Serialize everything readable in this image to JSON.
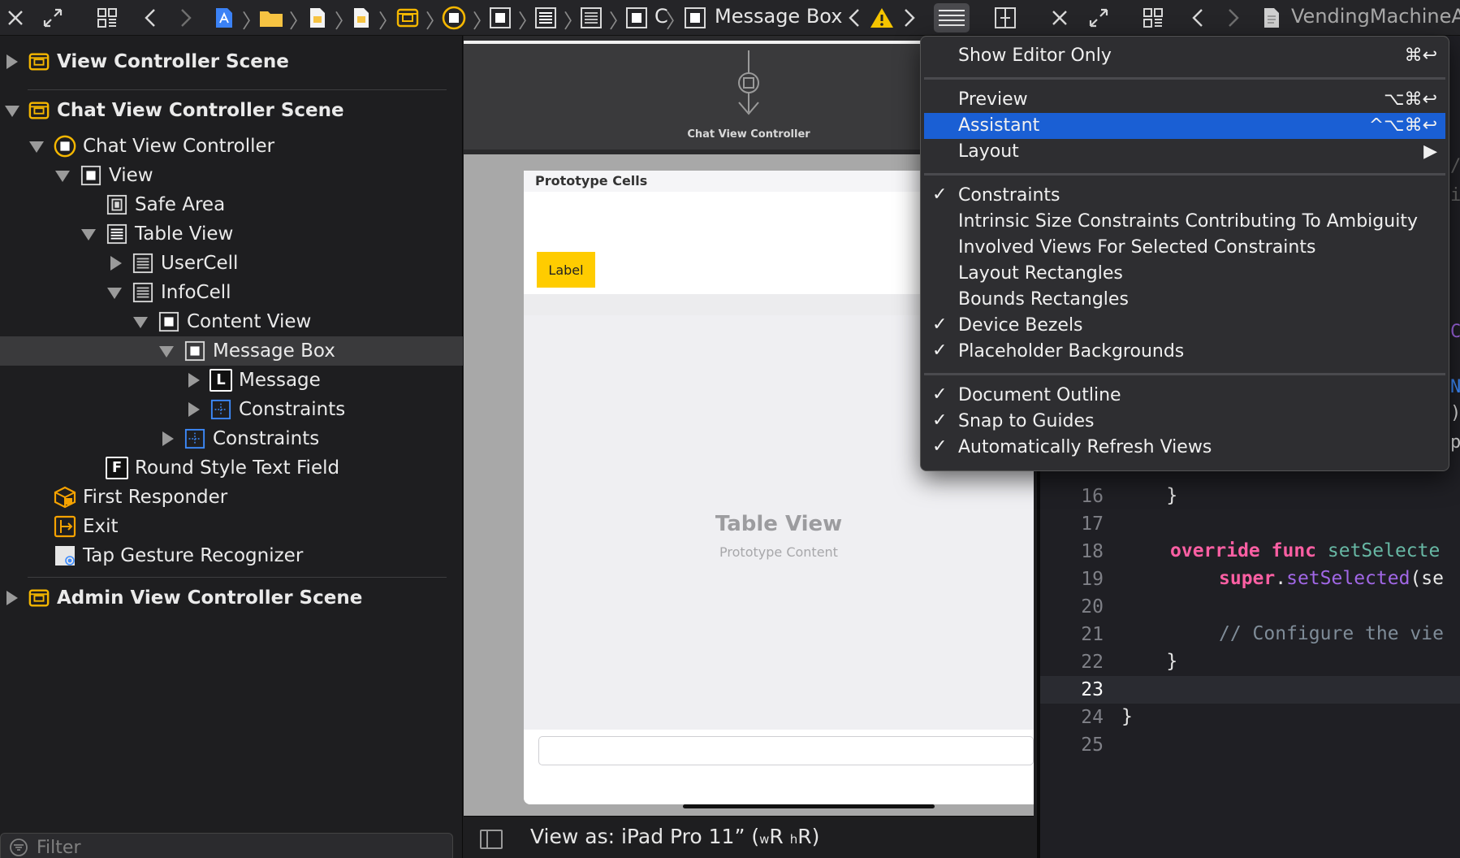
{
  "toolbar": {
    "breadcrumb_current": "Message Box",
    "breadcrumb_c": "C",
    "right_file": "VendingMachineApp"
  },
  "outline": {
    "rows": [
      {
        "label": "View Controller Scene"
      },
      {
        "label": "Chat View Controller Scene"
      },
      {
        "label": "Chat View Controller"
      },
      {
        "label": "View"
      },
      {
        "label": "Safe Area"
      },
      {
        "label": "Table View"
      },
      {
        "label": "UserCell"
      },
      {
        "label": "InfoCell"
      },
      {
        "label": "Content View"
      },
      {
        "label": "Message Box"
      },
      {
        "label": "Message"
      },
      {
        "label": "Constraints"
      },
      {
        "label": "Constraints"
      },
      {
        "label": "Round Style Text Field"
      },
      {
        "label": "First Responder"
      },
      {
        "label": "Exit"
      },
      {
        "label": "Tap Gesture Recognizer"
      },
      {
        "label": "Admin View Controller Scene"
      }
    ],
    "icon_letters": {
      "label": "L",
      "field": "F"
    },
    "filter_placeholder": "Filter"
  },
  "canvas": {
    "scene_label": "Chat View Controller",
    "prototype_cells": "Prototype Cells",
    "label_text": "Label",
    "table_view_title": "Table View",
    "table_view_sub": "Prototype Content",
    "view_as": "View as: iPad Pro 11” (",
    "view_as_w": "w",
    "view_as_r1": "R ",
    "view_as_h": "h",
    "view_as_r2": "R)"
  },
  "editor": {
    "lines": [
      {
        "num": "16",
        "code": "    }"
      },
      {
        "num": "17",
        "code": ""
      },
      {
        "num": "18",
        "kw": "override func ",
        "fn": "setSelecte"
      },
      {
        "num": "19",
        "kw": "super",
        "plain": ".",
        "mt": "setSelected",
        "rest": "(se"
      },
      {
        "num": "20",
        "code": ""
      },
      {
        "num": "21",
        "cm": "// Configure the vie"
      },
      {
        "num": "22",
        "code": "    }"
      },
      {
        "num": "23",
        "code": ""
      },
      {
        "num": "24",
        "code": "}"
      },
      {
        "num": "25",
        "code": ""
      }
    ],
    "edge_glyphs": [
      "/",
      "i",
      "C",
      "N",
      ")",
      "p"
    ]
  },
  "menu": {
    "items": [
      {
        "label": "Show Editor Only",
        "shortcut": "⌘↩",
        "checked": false
      },
      {
        "label": "Preview",
        "shortcut": "⌥⌘↩",
        "checked": false
      },
      {
        "label": "Assistant",
        "shortcut": "^⌥⌘↩",
        "checked": false
      },
      {
        "label": "Layout",
        "shortcut": "▶",
        "checked": false
      },
      {
        "label": "Constraints",
        "checked": true
      },
      {
        "label": "Intrinsic Size Constraints Contributing To Ambiguity",
        "checked": false
      },
      {
        "label": "Involved Views For Selected Constraints",
        "checked": false
      },
      {
        "label": "Layout Rectangles",
        "checked": false
      },
      {
        "label": "Bounds Rectangles",
        "checked": false
      },
      {
        "label": "Device Bezels",
        "checked": true
      },
      {
        "label": "Placeholder Backgrounds",
        "checked": true
      },
      {
        "label": "Document Outline",
        "checked": true
      },
      {
        "label": "Snap to Guides",
        "checked": true
      },
      {
        "label": "Automatically Refresh Views",
        "checked": true
      }
    ],
    "check_glyph": "✓"
  },
  "colors": {
    "menu_highlight": "#1a5fd4",
    "scene_yellow": "#f5b700",
    "label_yellow": "#ffcc00",
    "keyword_pink": "#fc5fa3",
    "method_purple": "#a167e6"
  }
}
